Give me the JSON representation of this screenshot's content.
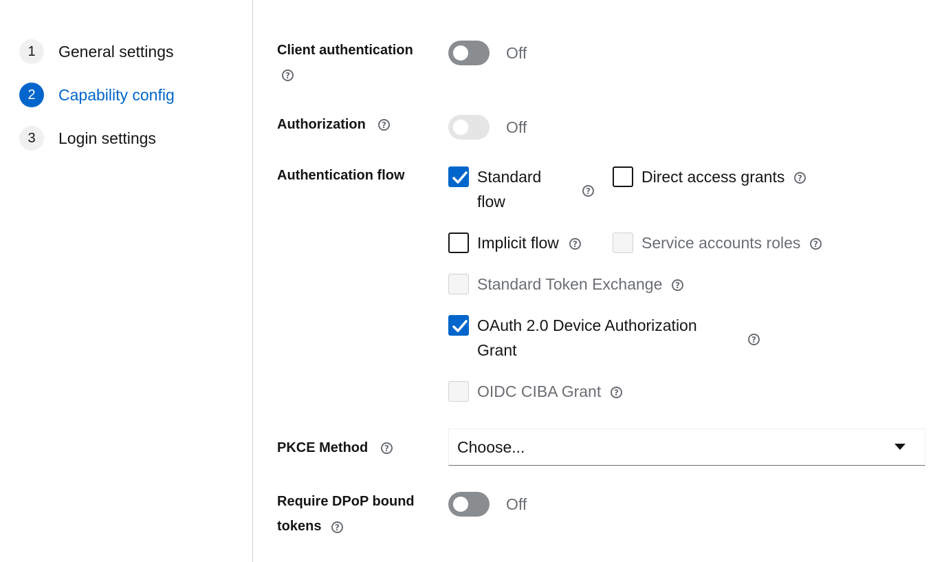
{
  "wizard": {
    "steps": [
      {
        "number": "1",
        "label": "General settings"
      },
      {
        "number": "2",
        "label": "Capability config"
      },
      {
        "number": "3",
        "label": "Login settings"
      }
    ],
    "current_step": "2"
  },
  "form": {
    "client_authentication": {
      "label": "Client authentication",
      "state_text": "Off",
      "help_icon": "help-icon"
    },
    "authorization": {
      "label": "Authorization",
      "state_text": "Off",
      "disabled": true,
      "help_icon": "help-icon"
    },
    "authentication_flow": {
      "label": "Authentication flow",
      "options": {
        "standard_flow": {
          "label_line1": "Standard",
          "label_line2": "flow",
          "checked": true,
          "disabled": false
        },
        "direct_access_grants": {
          "label": "Direct access grants",
          "checked": false,
          "disabled": false
        },
        "implicit_flow": {
          "label": "Implicit flow",
          "checked": false,
          "disabled": false
        },
        "service_accounts_roles": {
          "label": "Service accounts roles",
          "checked": false,
          "disabled": true
        },
        "standard_token_exchange": {
          "label": "Standard Token Exchange",
          "checked": false,
          "disabled": true
        },
        "oauth_device_grant": {
          "label_line1": "OAuth 2.0 Device Authorization",
          "label_line2": "Grant",
          "checked": true,
          "disabled": false
        },
        "oidc_ciba_grant": {
          "label": "OIDC CIBA Grant",
          "checked": false,
          "disabled": true
        }
      }
    },
    "pkce_method": {
      "label": "PKCE Method",
      "value": "Choose..."
    },
    "require_dpop": {
      "label_line1": "Require DPoP bound",
      "label_line2": "tokens",
      "state_text": "Off"
    }
  },
  "colors": {
    "accent": "#0066cc",
    "toggle_off": "#8a8d90",
    "toggle_disabled": "#e5e5e5",
    "muted_text": "#6a6e73"
  }
}
